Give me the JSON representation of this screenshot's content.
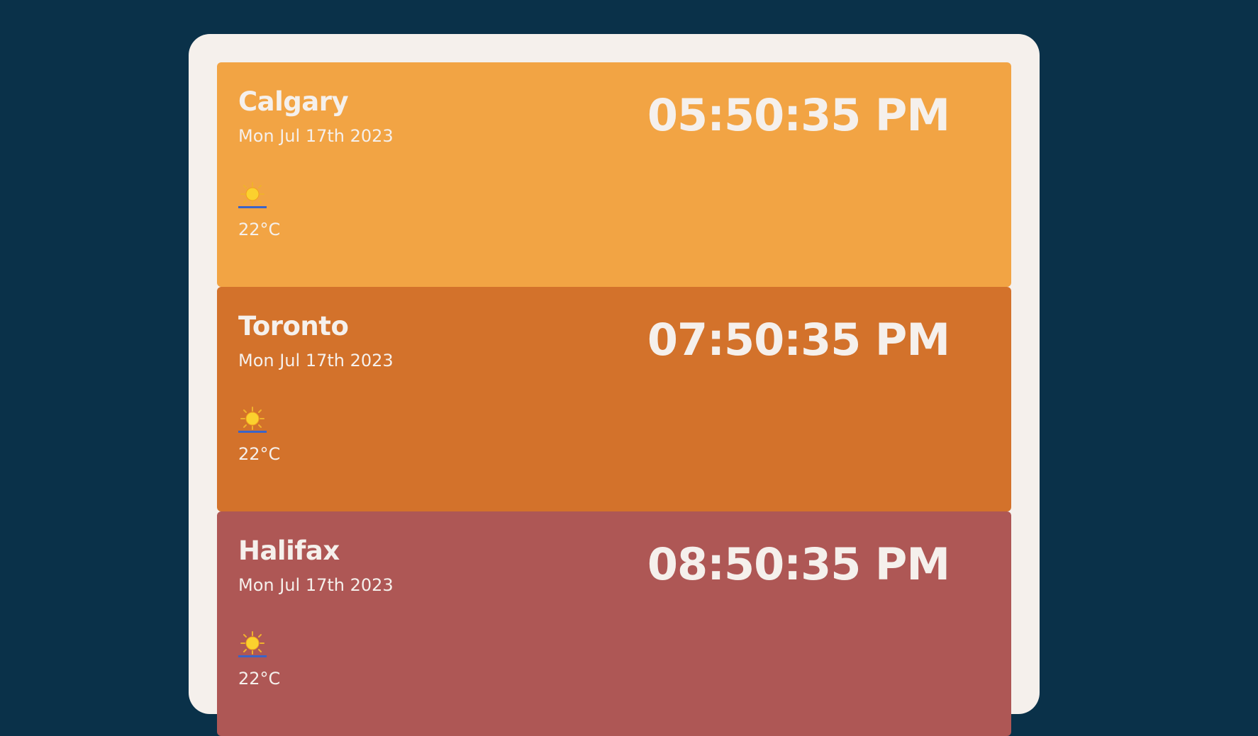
{
  "cities": [
    {
      "name": "Calgary",
      "date": "Mon Jul 17th 2023",
      "time": "05:50:35 PM",
      "temperature": "22°C",
      "icon": "sun-icon",
      "color": "#f2a444"
    },
    {
      "name": "Toronto",
      "date": "Mon Jul 17th 2023",
      "time": "07:50:35 PM",
      "temperature": "22°C",
      "icon": "sun-icon",
      "color": "#d3722b"
    },
    {
      "name": "Halifax",
      "date": "Mon Jul 17th 2023",
      "time": "08:50:35 PM",
      "temperature": "22°C",
      "icon": "sun-icon",
      "color": "#ae5755"
    }
  ]
}
